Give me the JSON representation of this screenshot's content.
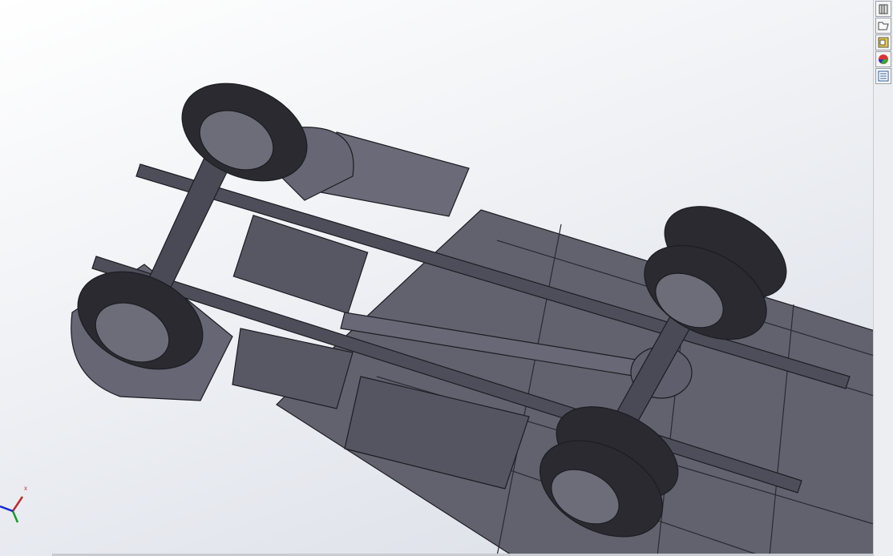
{
  "viewport": {
    "model": "truck-chassis-assembly",
    "shading_color": "#5a5a68",
    "edge_color": "#1c1c22"
  },
  "taskpane": {
    "buttons": [
      {
        "name": "resources-icon"
      },
      {
        "name": "design-library-icon"
      },
      {
        "name": "file-explorer-icon"
      },
      {
        "name": "appearances-icon"
      },
      {
        "name": "custom-properties-icon"
      }
    ]
  },
  "triad": {
    "x_label": "x",
    "x_color": "#c0282d",
    "y_color": "#1a9a2a",
    "z_color": "#1a2acc"
  }
}
